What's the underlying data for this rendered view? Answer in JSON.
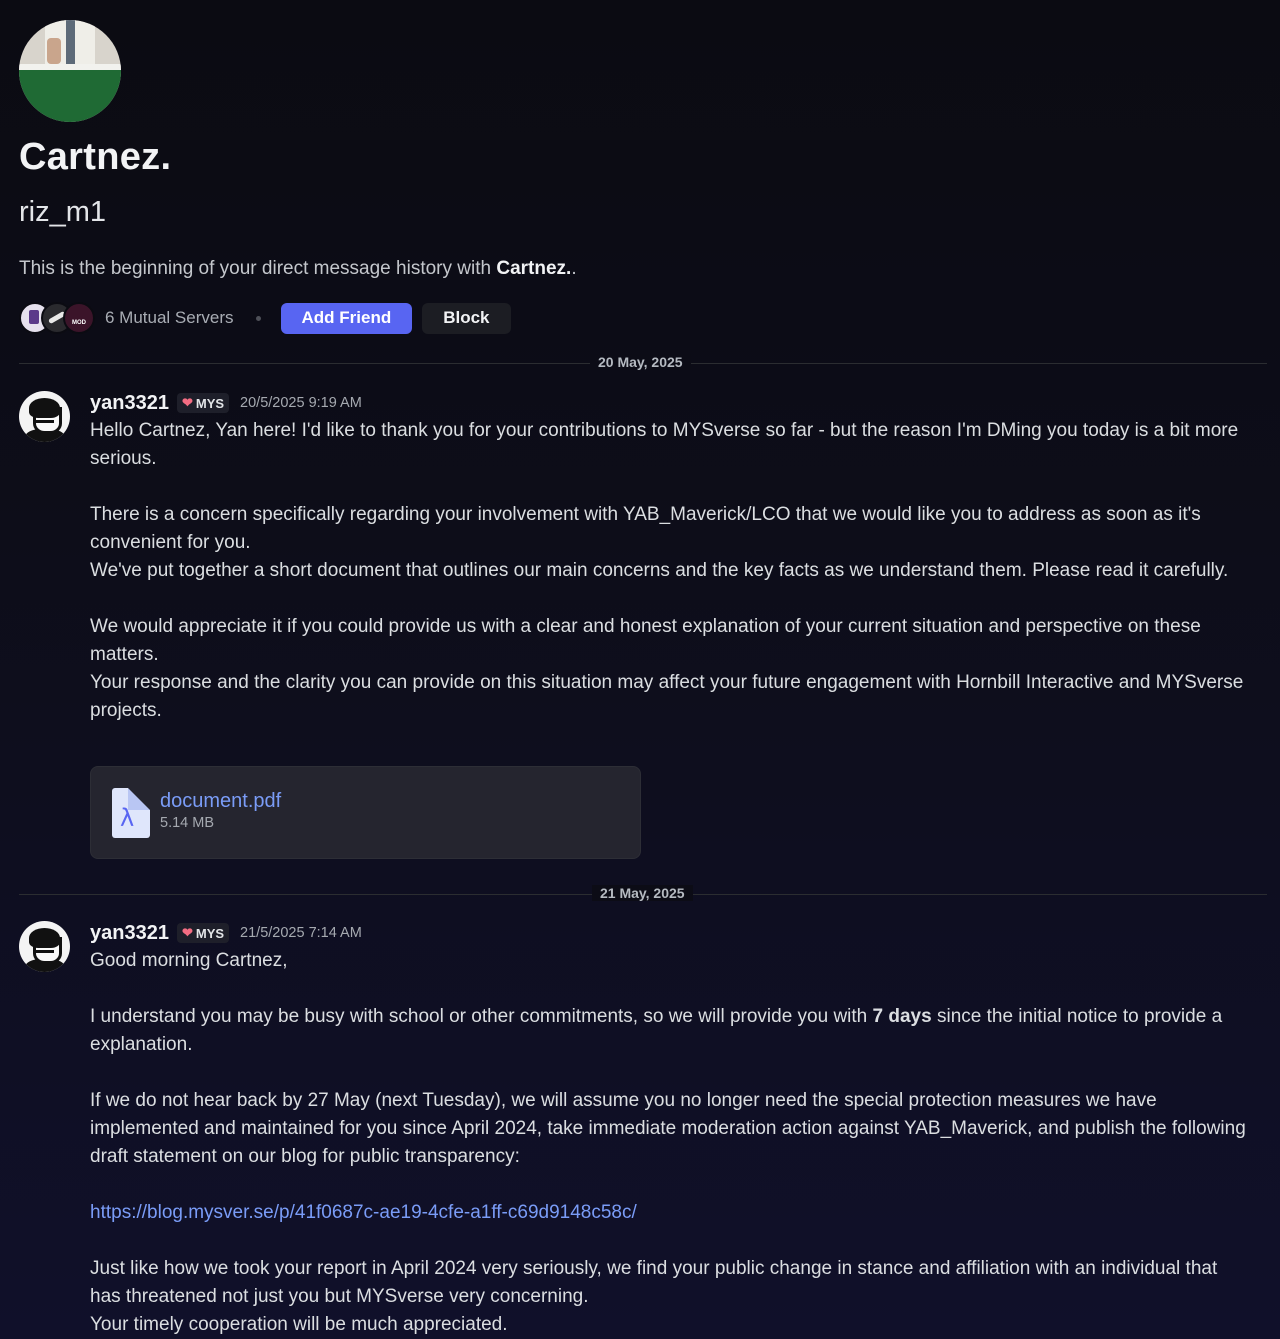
{
  "profile": {
    "display_name": "Cartnez.",
    "username": "riz_m1",
    "intro_prefix": "This is the beginning of your direct message history with ",
    "intro_name": "Cartnez.",
    "intro_suffix": ".",
    "mutual_servers_label": "6 Mutual Servers",
    "server_icon_text": "MOD",
    "add_friend_label": "Add Friend",
    "block_label": "Block"
  },
  "colors": {
    "accent": "#5865f2",
    "link": "#7a9cf7",
    "background": "#0b0b12"
  },
  "dates": [
    "20 May, 2025",
    "21 May, 2025"
  ],
  "messages": [
    {
      "author": "yan3321",
      "tag": "MYS",
      "timestamp": "20/5/2025 9:19 AM",
      "lines": [
        "Hello Cartnez, Yan here! I'd like to thank you for your contributions to MYSverse so far - but the reason I'm DMing you today is a bit more serious.",
        "There is a concern specifically regarding your involvement with YAB_Maverick/LCO that we would like you to address as soon as it's convenient for you.",
        "We've put together a short document that outlines our main concerns and the key facts as we understand them. Please read it carefully.",
        "We would appreciate it if you could provide us with a clear and honest explanation of your current situation and perspective on these matters.",
        "Your response and the clarity you can provide on this situation may affect your future engagement with Hornbill Interactive and MYSverse projects."
      ],
      "attachment": {
        "file_name": "document.pdf",
        "file_size": "5.14 MB",
        "icon": "pdf-file-icon"
      }
    },
    {
      "author": "yan3321",
      "tag": "MYS",
      "timestamp": "21/5/2025 7:14 AM",
      "greeting": "Good morning Cartnez,",
      "p1_pre": "I understand you may be busy with school or other commitments, so we will provide you with ",
      "p1_bold": "7 days",
      "p1_post": " since the initial notice to provide a explanation.",
      "p2": "If we do not hear back by 27 May (next Tuesday), we will assume you no longer need the special protection measures we have implemented and maintained for you since April 2024, take immediate moderation action against YAB_Maverick, and publish the following draft statement on our blog for public transparency:",
      "link": "https://blog.mysver.se/p/41f0687c-ae19-4cfe-a1ff-c69d9148c58c/",
      "p3": "Just like how we took your report in April 2024 very seriously, we find your public change in stance and affiliation with an individual that has threatened not just you but MYSverse very concerning.",
      "p4": "Your timely cooperation will be much appreciated."
    }
  ]
}
